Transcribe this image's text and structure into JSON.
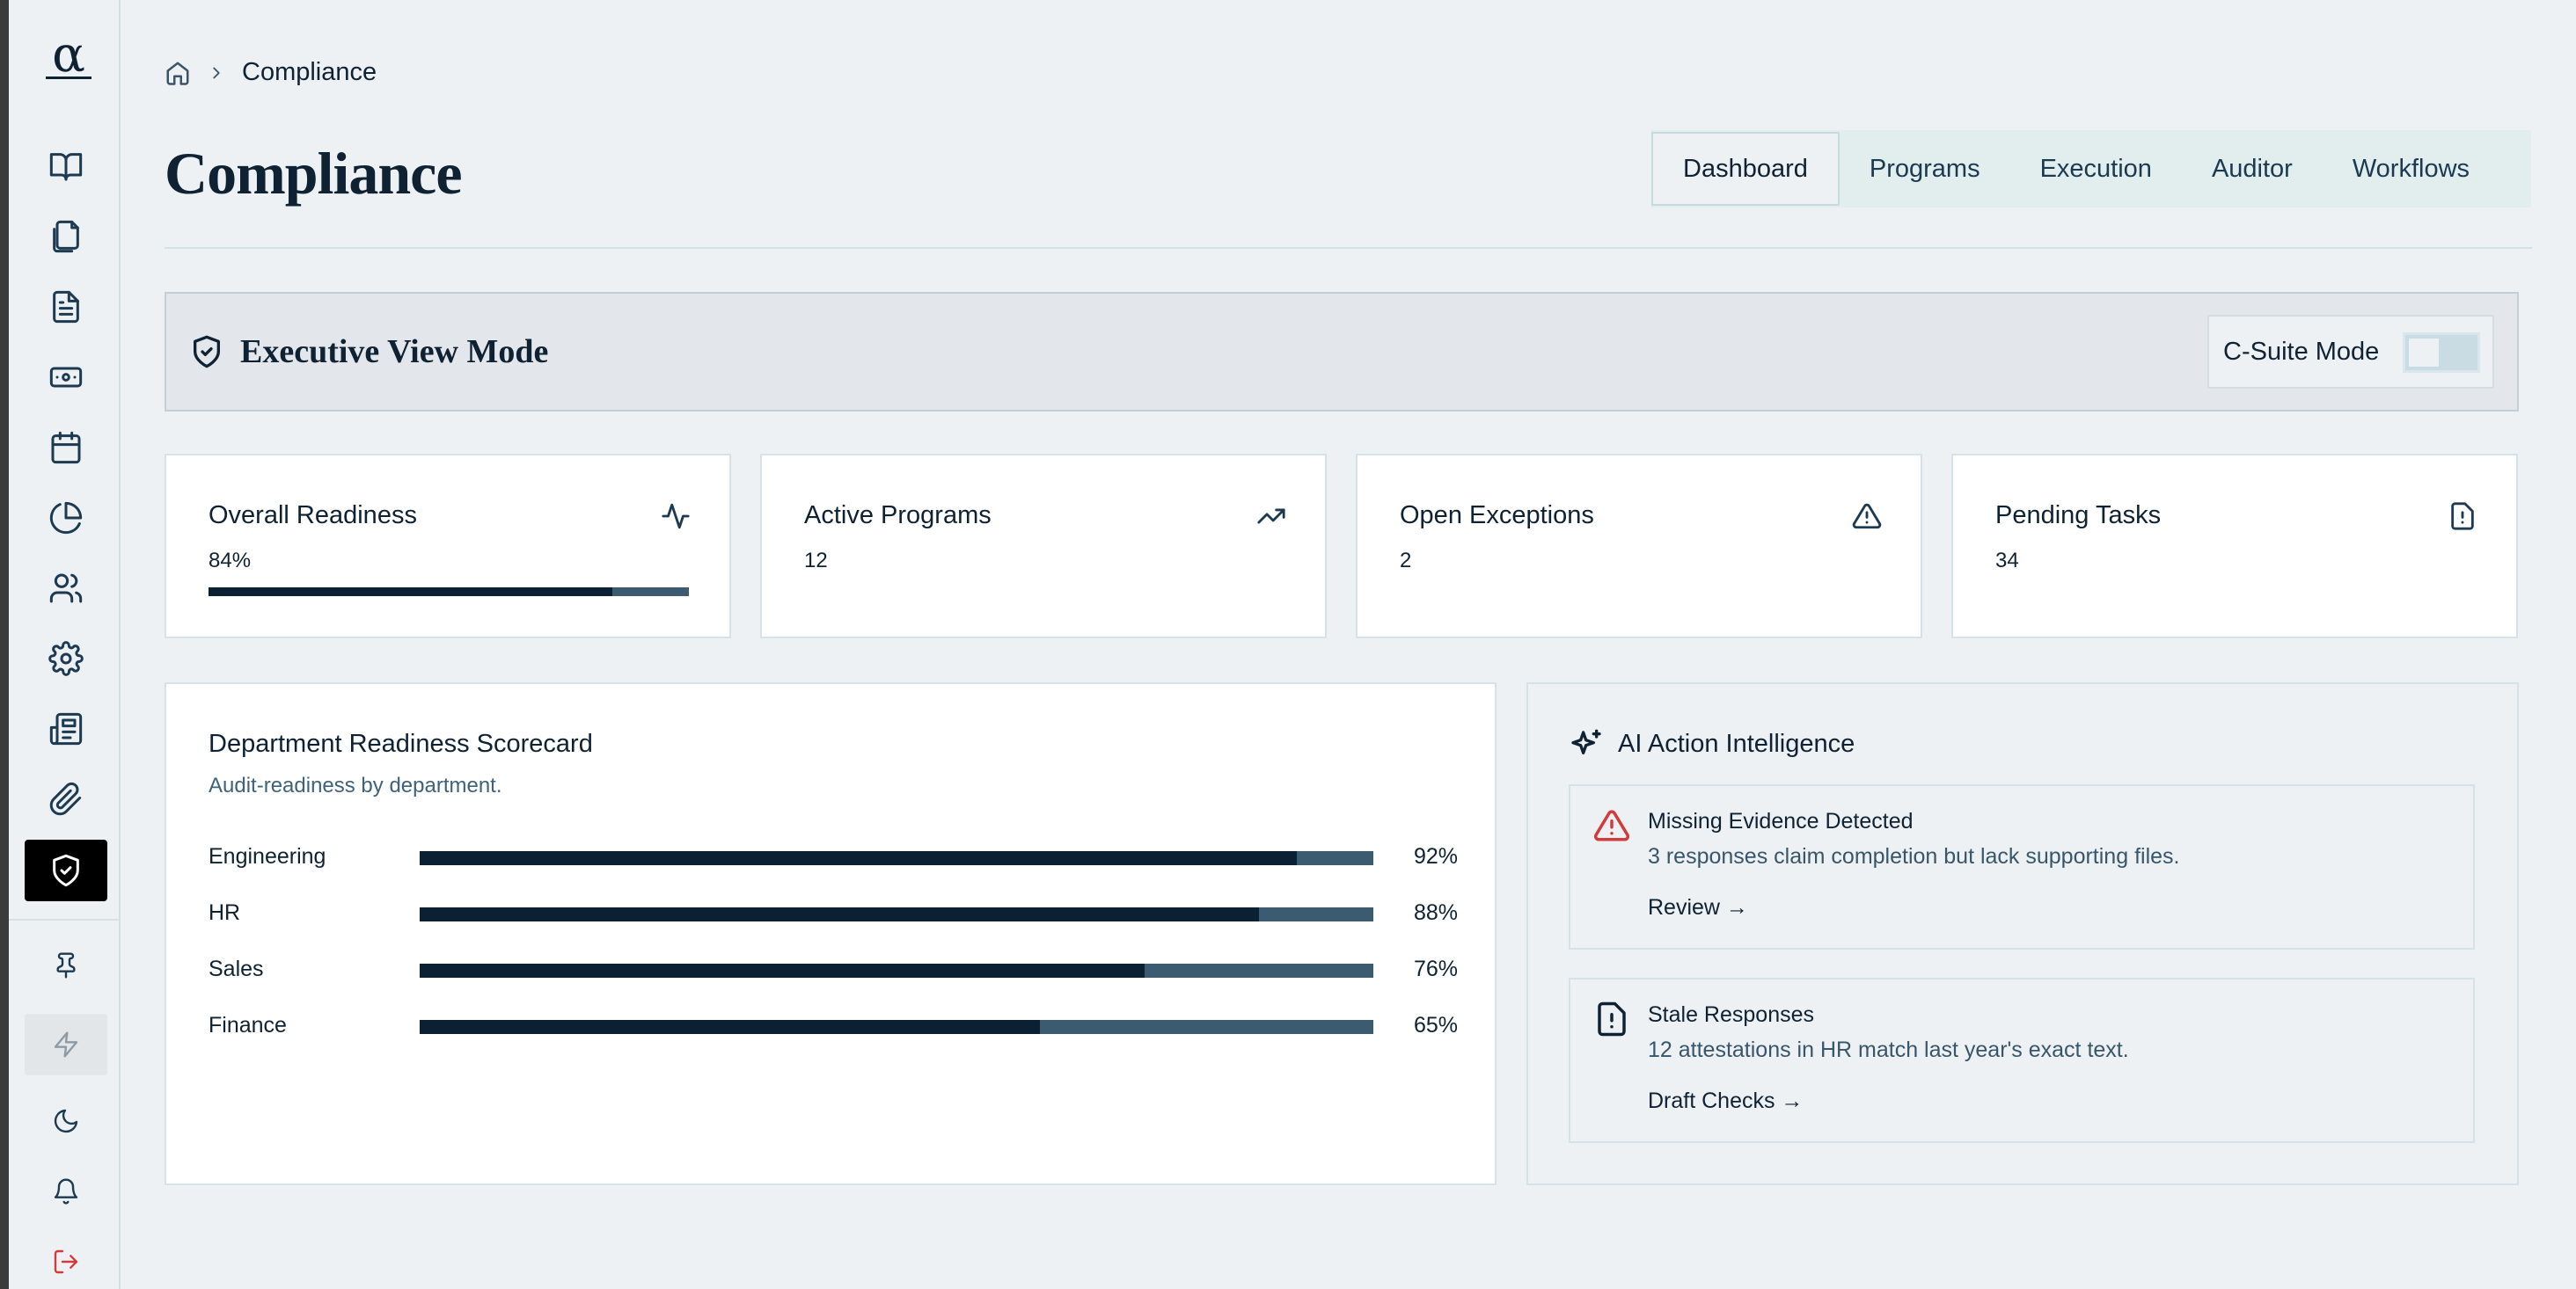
{
  "sidebar": {
    "logo": "α",
    "items": [
      {
        "icon": "book-icon"
      },
      {
        "icon": "copy-icon"
      },
      {
        "icon": "document-icon"
      },
      {
        "icon": "banknote-icon"
      },
      {
        "icon": "calendar-icon"
      },
      {
        "icon": "pie-chart-icon"
      },
      {
        "icon": "users-icon"
      },
      {
        "icon": "gear-icon"
      },
      {
        "icon": "newspaper-icon"
      },
      {
        "icon": "paperclip-icon"
      },
      {
        "icon": "shield-check-icon",
        "active": true
      }
    ],
    "bottom": [
      {
        "icon": "pin-icon"
      },
      {
        "icon": "lightning-icon"
      },
      {
        "icon": "moon-icon"
      },
      {
        "icon": "bell-icon"
      },
      {
        "icon": "logout-icon"
      }
    ]
  },
  "breadcrumb": {
    "icon": "home-icon",
    "current": "Compliance"
  },
  "page": {
    "title": "Compliance"
  },
  "tabs": [
    {
      "label": "Dashboard",
      "active": true
    },
    {
      "label": "Programs"
    },
    {
      "label": "Execution"
    },
    {
      "label": "Auditor"
    },
    {
      "label": "Workflows"
    }
  ],
  "exec_bar": {
    "title": "Executive View Mode",
    "toggle_label": "C-Suite Mode",
    "toggle_on": false
  },
  "stats": [
    {
      "label": "Overall Readiness",
      "value": "84%",
      "icon": "activity-icon",
      "progress": 0.84
    },
    {
      "label": "Active Programs",
      "value": "12",
      "icon": "trending-up-icon"
    },
    {
      "label": "Open Exceptions",
      "value": "2",
      "icon": "warning-icon"
    },
    {
      "label": "Pending Tasks",
      "value": "34",
      "icon": "file-alert-icon"
    }
  ],
  "scorecard": {
    "title": "Department Readiness Scorecard",
    "subtitle": "Audit-readiness by department.",
    "rows": [
      {
        "name": "Engineering",
        "pct": "92%",
        "value": 0.92
      },
      {
        "name": "HR",
        "pct": "88%",
        "value": 0.88
      },
      {
        "name": "Sales",
        "pct": "76%",
        "value": 0.76
      },
      {
        "name": "Finance",
        "pct": "65%",
        "value": 0.65
      }
    ]
  },
  "ai": {
    "title": "AI Action Intelligence",
    "alerts": [
      {
        "icon": "warning-icon",
        "color": "#d23b3b",
        "title": "Missing Evidence Detected",
        "desc": "3 responses claim completion but lack supporting files.",
        "link": "Review →"
      },
      {
        "icon": "file-alert-icon",
        "color": "#0f2233",
        "title": "Stale Responses",
        "desc": "12 attestations in HR match last year's exact text.",
        "link": "Draft Checks →"
      }
    ]
  },
  "colors": {
    "accent_dark": "#0b2133",
    "track": "#3c5a70",
    "danger": "#d23b3b"
  }
}
